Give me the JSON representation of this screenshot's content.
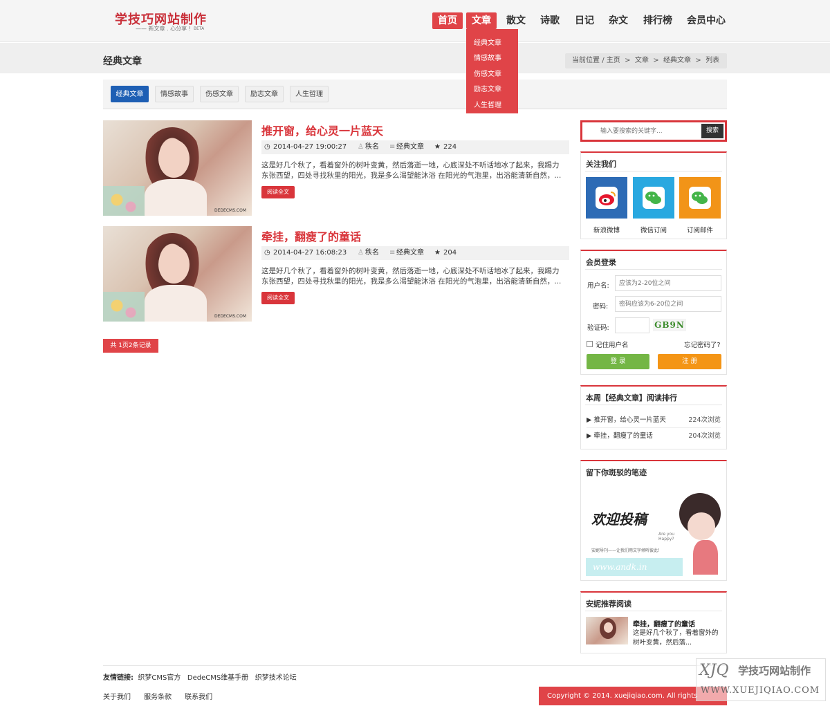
{
  "logo": {
    "title": "学技巧网站制作",
    "subtitle": "—— 新文章 . 心分享 !",
    "beta": "BETA"
  },
  "nav": [
    {
      "label": "首页",
      "active": true
    },
    {
      "label": "文章",
      "active": true
    },
    {
      "label": "散文"
    },
    {
      "label": "诗歌"
    },
    {
      "label": "日记"
    },
    {
      "label": "杂文"
    },
    {
      "label": "排行榜"
    },
    {
      "label": "会员中心"
    }
  ],
  "dropdown": [
    "经典文章",
    "情感故事",
    "伤感文章",
    "励志文章",
    "人生哲理"
  ],
  "section_title": "经典文章",
  "breadcrumb": {
    "prefix": "当前位置",
    "items": [
      "主页",
      "文章",
      "经典文章",
      "列表"
    ]
  },
  "tabs": [
    "经典文章",
    "情感故事",
    "伤感文章",
    "励志文章",
    "人生哲理"
  ],
  "articles": [
    {
      "title": "推开窗，给心灵一片蓝天",
      "date": "2014-04-27 19:00:27",
      "author": "秩名",
      "category": "经典文章",
      "views": "224",
      "desc": "这是好几个秋了，看着窗外的树叶变黄，然后落逝一地，心底深处不听话地冰了起来，我踢力东张西望，四处寻找秋里的阳光，我是多么渴望能沐浴 在阳光的气泡里，出浴能清新自然，...",
      "button": "阅读全文",
      "image_watermark": "DEDECMS.COM"
    },
    {
      "title": "牵挂，翻瘦了的童话",
      "date": "2014-04-27 16:08:23",
      "author": "秩名",
      "category": "经典文章",
      "views": "204",
      "desc": "这是好几个秋了，看着窗外的树叶变黄，然后落逝一地，心底深处不听话地冰了起来，我踢力东张西望，四处寻找秋里的阳光，我是多么渴望能沐浴 在阳光的气泡里，出浴能清新自然，...",
      "button": "阅读全文",
      "image_watermark": "DEDECMS.COM"
    }
  ],
  "pager": "共 1页2条记录",
  "search": {
    "placeholder": "输入要搜索的关键字...",
    "button": "搜索"
  },
  "follow": {
    "title": "关注我们",
    "items": [
      {
        "label": "新浪微博",
        "color": "#2d6bb5",
        "icon": "weibo-icon"
      },
      {
        "label": "微信订阅",
        "color": "#29a8e0",
        "icon": "wechat-icon"
      },
      {
        "label": "订阅邮件",
        "color": "#f29418",
        "icon": "mail-icon"
      }
    ]
  },
  "login": {
    "title": "会员登录",
    "user_label": "用户名:",
    "user_placeholder": "应该为2-20位之间",
    "pass_label": "密码:",
    "pass_placeholder": "密码应该为6-20位之间",
    "code_label": "验证码:",
    "captcha": "GB9N",
    "remember": "记住用户名",
    "forgot": "忘记密码了?",
    "login_btn": "登 录",
    "register_btn": "注 册"
  },
  "ranking": {
    "title": "本周【经典文章】阅读排行",
    "items": [
      {
        "title": "推开窗，给心灵一片蓝天",
        "views": "224次浏览"
      },
      {
        "title": "牵挂，翻瘦了的童话",
        "views": "204次浏览"
      }
    ]
  },
  "guestbook": {
    "title": "留下你斑驳的笔迹",
    "banner_text": "欢迎投稿",
    "banner_small": "安妮导刊——让我们用文字倾听彼此！",
    "banner_url": "www.andk.in",
    "banner_tag": "Are you Happy?"
  },
  "recommend": {
    "title": "安妮推荐阅读",
    "item_title": "牵挂，翻瘦了的童话",
    "item_desc": "这是好几个秋了，看着窗外的树叶变黄，然后落..."
  },
  "footer": {
    "links_label": "友情链接:",
    "links": [
      "织梦CMS官方",
      "DedeCMS维基手册",
      "织梦技术论坛"
    ],
    "bottom": [
      "关于我们",
      "服务条款",
      "联系我们"
    ],
    "copyright": "Copyright © 2014. xuejiqiao.com. All rights reserved."
  },
  "watermark": {
    "text": "学技巧网站制作",
    "url": "WWW.XUEJIQIAO.COM"
  },
  "colors": {
    "accent": "#e04448",
    "tab_active": "#1e5fb4",
    "login": "#74b645",
    "register": "#f49515"
  }
}
